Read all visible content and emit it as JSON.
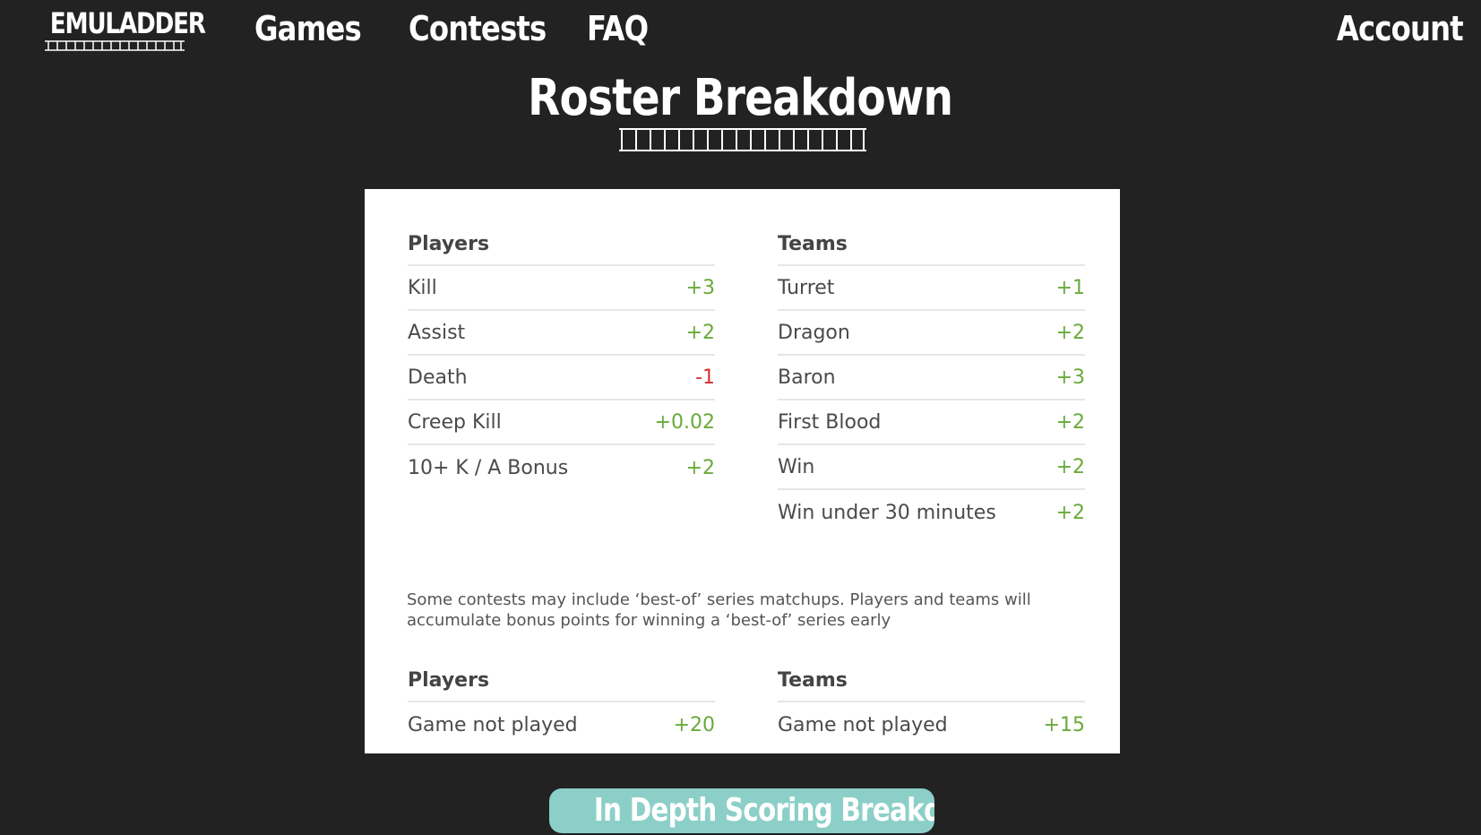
{
  "nav": {
    "logo": "EMULADDER",
    "links": [
      "Games",
      "Contests",
      "FAQ"
    ],
    "account": "Account"
  },
  "page": {
    "title": "Roster Breakdown"
  },
  "scoring": {
    "players": {
      "heading": "Players",
      "rows": [
        {
          "label": "Kill",
          "value": "+3"
        },
        {
          "label": "Assist",
          "value": "+2"
        },
        {
          "label": "Death",
          "value": "-1"
        },
        {
          "label": "Creep Kill",
          "value": "+0.02"
        },
        {
          "label": "10+ K / A Bonus",
          "value": "+2"
        }
      ]
    },
    "teams": {
      "heading": "Teams",
      "rows": [
        {
          "label": "Turret",
          "value": "+1"
        },
        {
          "label": "Dragon",
          "value": "+2"
        },
        {
          "label": "Baron",
          "value": "+3"
        },
        {
          "label": "First Blood",
          "value": "+2"
        },
        {
          "label": "Win",
          "value": "+2"
        },
        {
          "label": "Win under 30 minutes",
          "value": "+2"
        }
      ]
    },
    "note": "Some contests may include ‘best-of’ series matchups. Players and teams will accumulate bonus points for winning a ‘best-of’ series early",
    "bonus_players": {
      "heading": "Players",
      "rows": [
        {
          "label": "Game not played",
          "value": "+20"
        }
      ]
    },
    "bonus_teams": {
      "heading": "Teams",
      "rows": [
        {
          "label": "Game not played",
          "value": "+15"
        }
      ]
    }
  },
  "cta": {
    "label": "In Depth Scoring Breakdown"
  },
  "colors": {
    "background": "#222222",
    "positive": "#6aaa3a",
    "negative": "#d03030",
    "button": "#8ccfc8"
  }
}
